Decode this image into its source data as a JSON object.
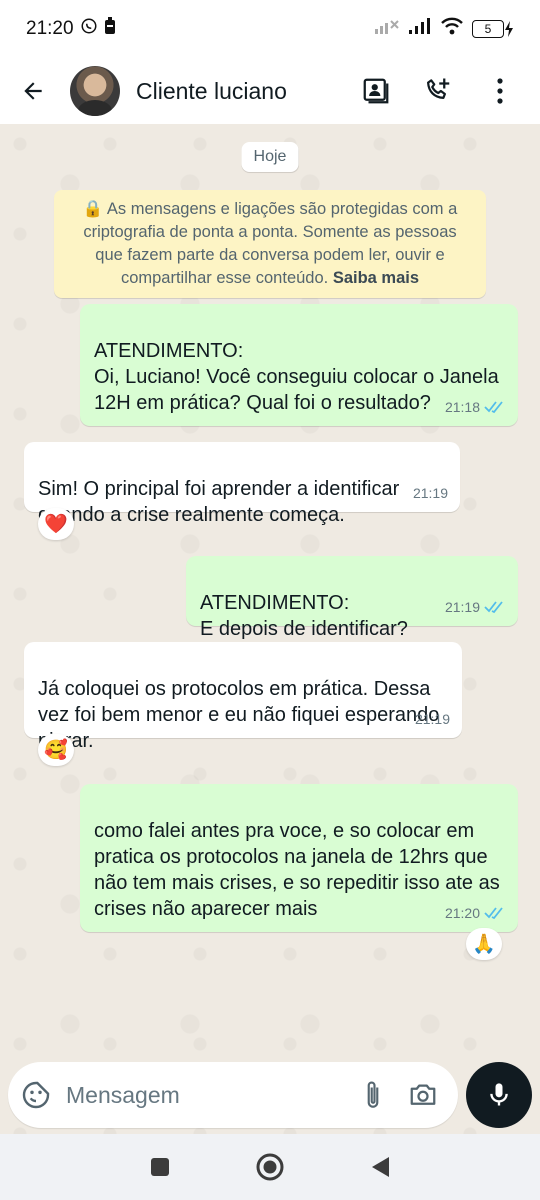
{
  "status_bar": {
    "time": "21:20",
    "battery": "5"
  },
  "header": {
    "contact_name": "Cliente luciano"
  },
  "chat": {
    "day_label": "Hoje",
    "encryption_note": "As mensagens e ligações são protegidas com a criptografia de ponta a ponta. Somente as pessoas que fazem parte da conversa podem ler, ouvir e compartilhar esse conteúdo.",
    "encryption_link": "Saiba mais",
    "messages": [
      {
        "direction": "out",
        "text": "ATENDIMENTO:\nOi, Luciano! Você conseguiu colocar o Janela 12H em prática? Qual foi o resultado?",
        "time": "21:18"
      },
      {
        "direction": "in",
        "text": "Sim! O principal foi aprender a identificar quando a crise realmente começa.",
        "time": "21:19",
        "reaction": "❤️"
      },
      {
        "direction": "out",
        "text": "ATENDIMENTO:\nE depois de identificar?",
        "time": "21:19"
      },
      {
        "direction": "in",
        "text": "Já coloquei os protocolos em prática. Dessa vez foi bem menor e eu não fiquei esperando piorar.",
        "time": "21:19",
        "reaction": "🥰"
      },
      {
        "direction": "out",
        "text": "como falei antes pra voce, e so colocar em pratica os protocolos na janela de 12hrs que não tem mais crises, e so repeditir isso ate as crises não aparecer mais",
        "time": "21:20",
        "reaction": "🙏"
      }
    ]
  },
  "composer": {
    "placeholder": "Mensagem"
  },
  "colors": {
    "outgoing_bubble": "#d9fdd3",
    "incoming_bubble": "#ffffff",
    "read_ticks": "#53bdeb",
    "encryption_bg": "#fdf4c5"
  },
  "icons": [
    "back-arrow-icon",
    "contact-card-icon",
    "add-call-icon",
    "more-vert-icon",
    "emoji-sticker-icon",
    "attach-icon",
    "camera-icon",
    "mic-icon",
    "nav-square-icon",
    "nav-home-icon",
    "nav-back-icon"
  ]
}
